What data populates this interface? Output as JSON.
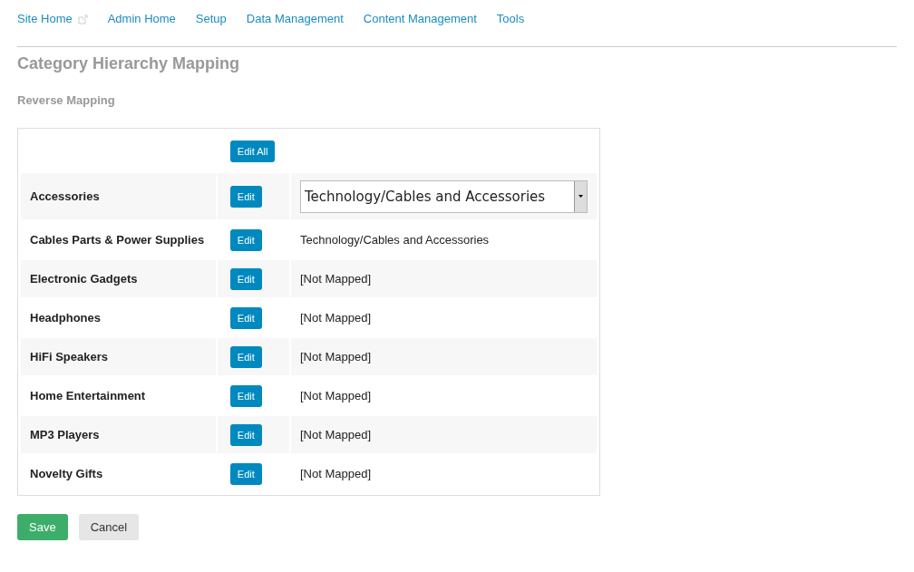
{
  "nav": [
    {
      "label": "Site Home",
      "external": true
    },
    {
      "label": "Admin Home",
      "external": false
    },
    {
      "label": "Setup",
      "external": false
    },
    {
      "label": "Data Management",
      "external": false
    },
    {
      "label": "Content Management",
      "external": false
    },
    {
      "label": "Tools",
      "external": false
    }
  ],
  "title": "Category Hierarchy Mapping",
  "subtitle": "Reverse Mapping",
  "edit_all_button": "Edit All",
  "rows": [
    {
      "category": "Accessories",
      "button": "Edit",
      "kind": "select",
      "mapping": "Technology/Cables and Accessories"
    },
    {
      "category": "Cables Parts & Power Supplies",
      "button": "Edit",
      "kind": "text",
      "mapping": "Technology/Cables and Accessories"
    },
    {
      "category": "Electronic Gadgets",
      "button": "Edit",
      "kind": "text",
      "mapping": "[Not Mapped]"
    },
    {
      "category": "Headphones",
      "button": "Edit",
      "kind": "text",
      "mapping": "[Not Mapped]"
    },
    {
      "category": "HiFi Speakers",
      "button": "Edit",
      "kind": "text",
      "mapping": "[Not Mapped]"
    },
    {
      "category": "Home Entertainment",
      "button": "Edit",
      "kind": "text",
      "mapping": "[Not Mapped]"
    },
    {
      "category": "MP3 Players",
      "button": "Edit",
      "kind": "text",
      "mapping": "[Not Mapped]"
    },
    {
      "category": "Novelty Gifts",
      "button": "Edit",
      "kind": "text",
      "mapping": "[Not Mapped]"
    }
  ],
  "buttons": [
    {
      "label": "Save",
      "kind": "primary"
    },
    {
      "label": "Cancel",
      "kind": "secondary"
    }
  ]
}
